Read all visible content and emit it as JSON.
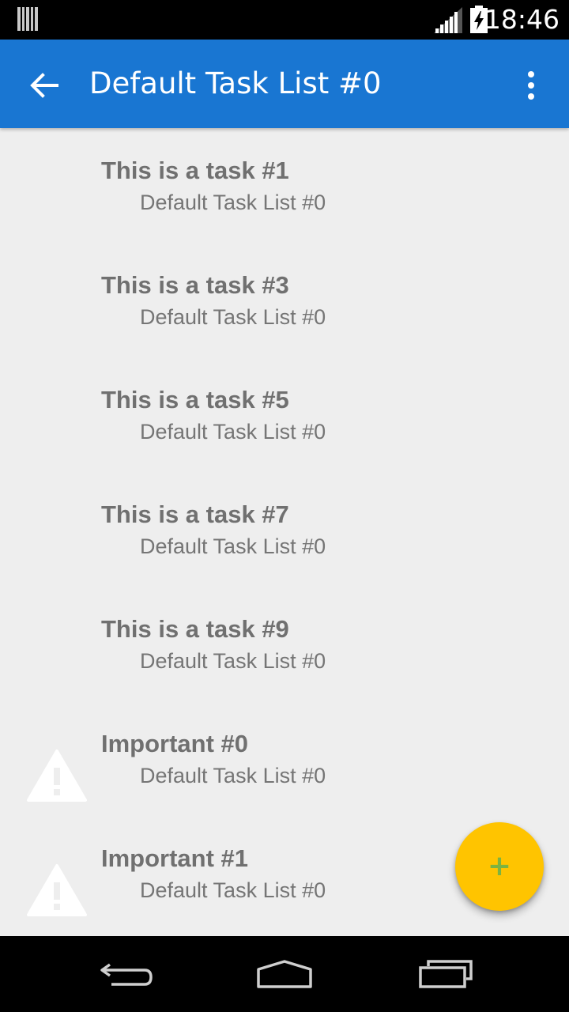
{
  "status_bar": {
    "time": "18:46",
    "icons": [
      "notification-icon",
      "signal-icon",
      "battery-charging-icon"
    ]
  },
  "app_bar": {
    "back_icon": "arrow-back-icon",
    "title": "Default Task List #0",
    "overflow_icon": "more-vert-icon"
  },
  "tasks": [
    {
      "title": "This is a task #1",
      "list": "Default Task List #0",
      "important": false
    },
    {
      "title": "This is a task #3",
      "list": "Default Task List #0",
      "important": false
    },
    {
      "title": "This is a task #5",
      "list": "Default Task List #0",
      "important": false
    },
    {
      "title": "This is a task #7",
      "list": "Default Task List #0",
      "important": false
    },
    {
      "title": "This is a task #9",
      "list": "Default Task List #0",
      "important": false
    },
    {
      "title": "Important #0",
      "list": "Default Task List #0",
      "important": true
    },
    {
      "title": "Important #1",
      "list": "Default Task List #0",
      "important": true
    }
  ],
  "fab": {
    "label": "+",
    "icon": "add-icon",
    "color": "#ffc400",
    "icon_color": "#7cb342"
  },
  "nav_bar": {
    "icons": [
      "back-nav-icon",
      "home-nav-icon",
      "recents-nav-icon"
    ]
  },
  "colors": {
    "primary": "#1976d2",
    "background": "#eeeeee",
    "task_text": "#707070"
  }
}
